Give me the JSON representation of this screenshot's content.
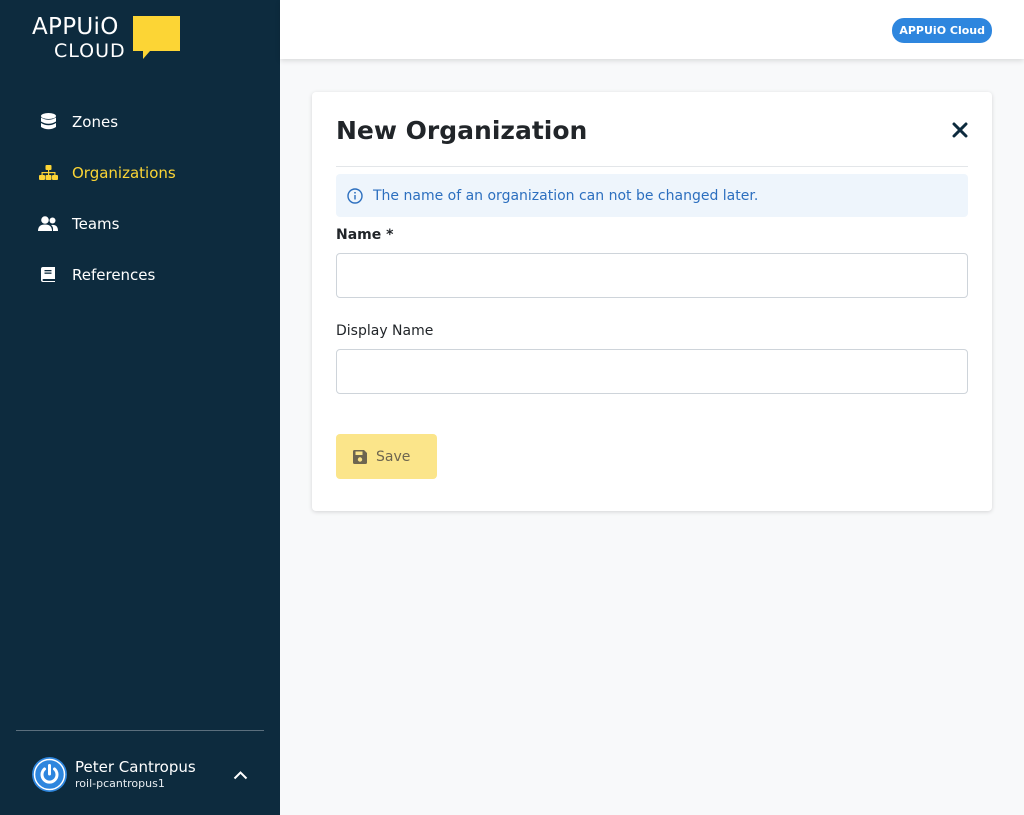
{
  "brand": {
    "logo_top": "APPUiO",
    "logo_bottom": "CLOUD",
    "accent_color": "#fcd535",
    "sidebar_color": "#0d2b3e"
  },
  "sidebar": {
    "items": [
      {
        "label": "Zones",
        "icon": "database-icon",
        "active": false
      },
      {
        "label": "Organizations",
        "icon": "sitemap-icon",
        "active": true
      },
      {
        "label": "Teams",
        "icon": "users-icon",
        "active": false
      },
      {
        "label": "References",
        "icon": "book-icon",
        "active": false
      }
    ]
  },
  "user": {
    "name": "Peter Cantropus",
    "login": "roil-pcantropus1",
    "avatar_icon": "power-icon",
    "toggle_icon": "chevron-up-icon"
  },
  "topbar": {
    "badge": "APPUiO Cloud"
  },
  "dialog": {
    "title": "New Organization",
    "close_icon": "close-icon",
    "info_icon": "info-circle-icon",
    "info": "The name of an organization can not be changed later.",
    "fields": {
      "name_label": "Name *",
      "name_value": "",
      "display_label": "Display Name",
      "display_value": ""
    },
    "save_label": "Save",
    "save_icon": "floppy-disk-icon"
  }
}
